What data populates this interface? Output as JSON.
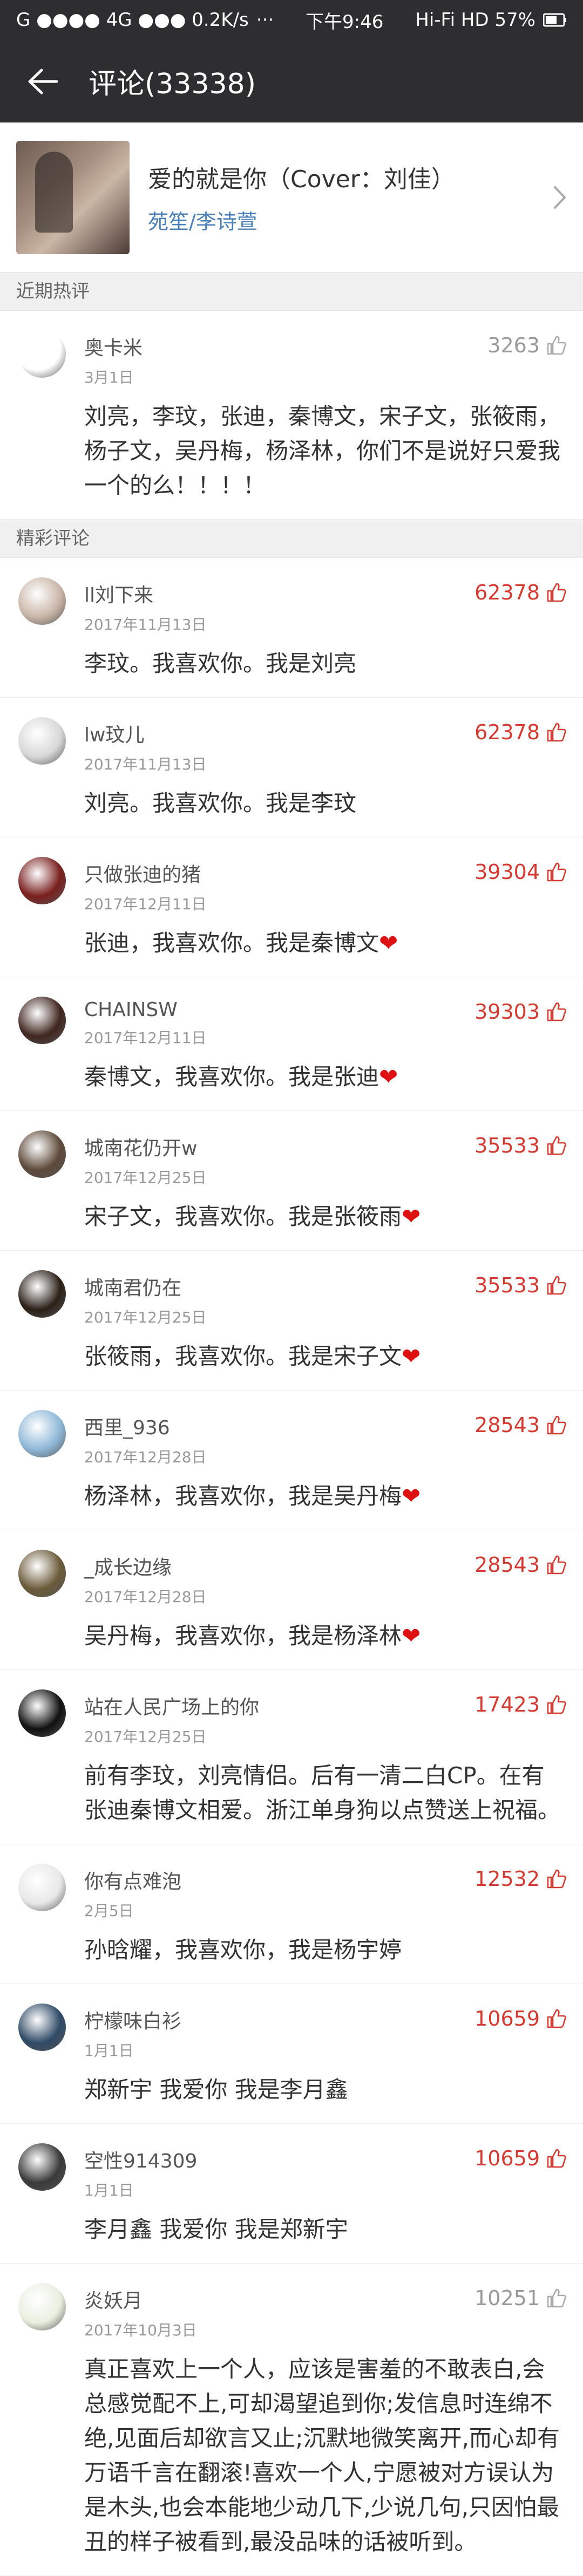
{
  "status_bar": {
    "left": "G ●●●● 4G ●●● 0.2K/s",
    "time": "下午9:46",
    "right": "Hi-Fi  HD  57%"
  },
  "header": {
    "title": "评论(33338)"
  },
  "song": {
    "title": "爱的就是你（Cover：刘佳）",
    "artist": "苑笙/李诗萱"
  },
  "sections": {
    "recent": "近期热评",
    "featured": "精彩评论"
  },
  "recent_comments": [
    {
      "user": "奥卡米",
      "date": "3月1日",
      "likes": "3263",
      "text": "刘亮，李玟，张迪，秦博文，宋子文，张筱雨，杨子文，吴丹梅，杨泽林，你们不是说好只爱我一个的么！！！！"
    }
  ],
  "featured_comments": [
    {
      "user": "ll刘下来",
      "date": "2017年11月13日",
      "likes": "62378",
      "text": "李玟。我喜欢你。我是刘亮",
      "heart": ""
    },
    {
      "user": "lw玟儿",
      "date": "2017年11月13日",
      "likes": "62378",
      "text": "刘亮。我喜欢你。我是李玟",
      "heart": ""
    },
    {
      "user": "只做张迪的猪",
      "date": "2017年12月11日",
      "likes": "39304",
      "text": "张迪，我喜欢你。我是秦博文",
      "heart": "❤"
    },
    {
      "user": "CHAINSW",
      "date": "2017年12月11日",
      "likes": "39303",
      "text": "秦博文，我喜欢你。我是张迪",
      "heart": "❤"
    },
    {
      "user": "城南花仍开w",
      "date": "2017年12月25日",
      "likes": "35533",
      "text": "宋子文，我喜欢你。我是张筱雨",
      "heart": "❤"
    },
    {
      "user": "城南君仍在",
      "date": "2017年12月25日",
      "likes": "35533",
      "text": "张筱雨，我喜欢你。我是宋子文",
      "heart": "❤"
    },
    {
      "user": "西里_936",
      "date": "2017年12月28日",
      "likes": "28543",
      "text": "杨泽林，我喜欢你，我是吴丹梅",
      "heart": "❤"
    },
    {
      "user": "_成长边缘",
      "date": "2017年12月28日",
      "likes": "28543",
      "text": "吴丹梅，我喜欢你，我是杨泽林",
      "heart": "❤"
    },
    {
      "user": "站在人民广场上的你",
      "date": "2017年12月25日",
      "likes": "17423",
      "text": "前有李玟，刘亮情侣。后有一清二白CP。在有张迪秦博文相爱。浙江单身狗以点赞送上祝福。",
      "heart": ""
    },
    {
      "user": "你有点难泡",
      "date": "2月5日",
      "likes": "12532",
      "text": "孙晗耀，我喜欢你，我是杨宇婷",
      "heart": ""
    },
    {
      "user": "柠檬味白衫",
      "date": "1月1日",
      "likes": "10659",
      "text": "郑新宇  我爱你  我是李月鑫",
      "heart": ""
    },
    {
      "user": "空性914309",
      "date": "1月1日",
      "likes": "10659",
      "text": "李月鑫    我爱你    我是郑新宇",
      "heart": ""
    },
    {
      "user": "炎妖月",
      "date": "2017年10月3日",
      "likes": "10251",
      "text": "真正喜欢上一个人，应该是害羞的不敢表白,会总感觉配不上,可却渴望追到你;发信息时连绵不绝,见面后却欲言又止;沉默地微笑离开,而心却有万语千言在翻滚!喜欢一个人,宁愿被对方误认为是木头,也会本能地少动几下,少说几句,只因怕最丑的样子被看到,最没品味的话被听到。",
      "heart": ""
    }
  ],
  "colors": {
    "header_bg": "#2e2e30",
    "hot_like": "#d33a31",
    "cold_like": "#999999",
    "artist_link": "#4a7fb8"
  },
  "icons": {
    "back": "arrow-left-icon",
    "like": "thumbs-up-icon",
    "chevron": "chevron-right-icon"
  }
}
